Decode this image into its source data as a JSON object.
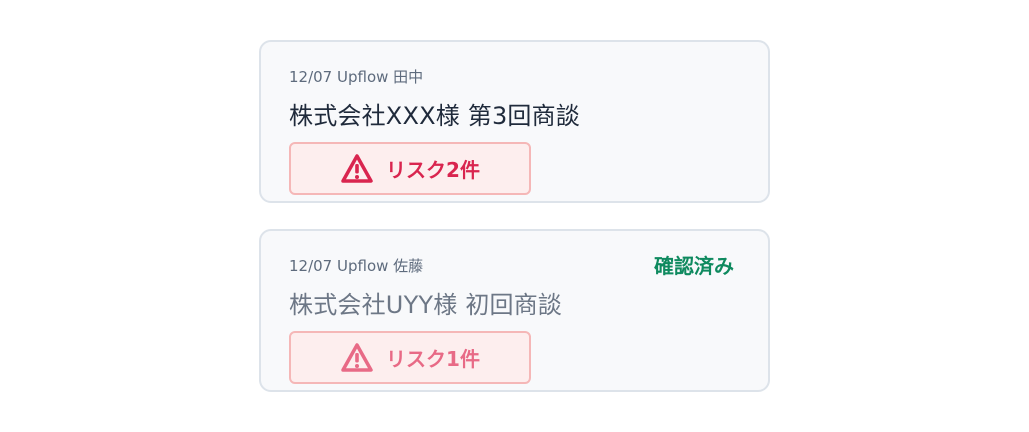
{
  "cards": [
    {
      "meta": "12/07 Upflow 田中",
      "title": "株式会社XXX様 第3回商談",
      "risk_label": "リスク2件",
      "warning_color": "#d9254f",
      "confirmed": false
    },
    {
      "meta": "12/07 Upflow 佐藤",
      "title": "株式会社UYY様 初回商談",
      "risk_label": "リスク1件",
      "warning_color": "#e86a86",
      "confirmed": true,
      "confirmed_label": "確認済み"
    }
  ],
  "colors": {
    "card_bg": "#f8f9fb",
    "card_border": "#dde3ea",
    "risk_bg": "#fdeeee",
    "risk_border": "#f5b7b7",
    "confirmed": "#0f8a5f"
  },
  "icons": {
    "warning": "warning-triangle-icon"
  }
}
